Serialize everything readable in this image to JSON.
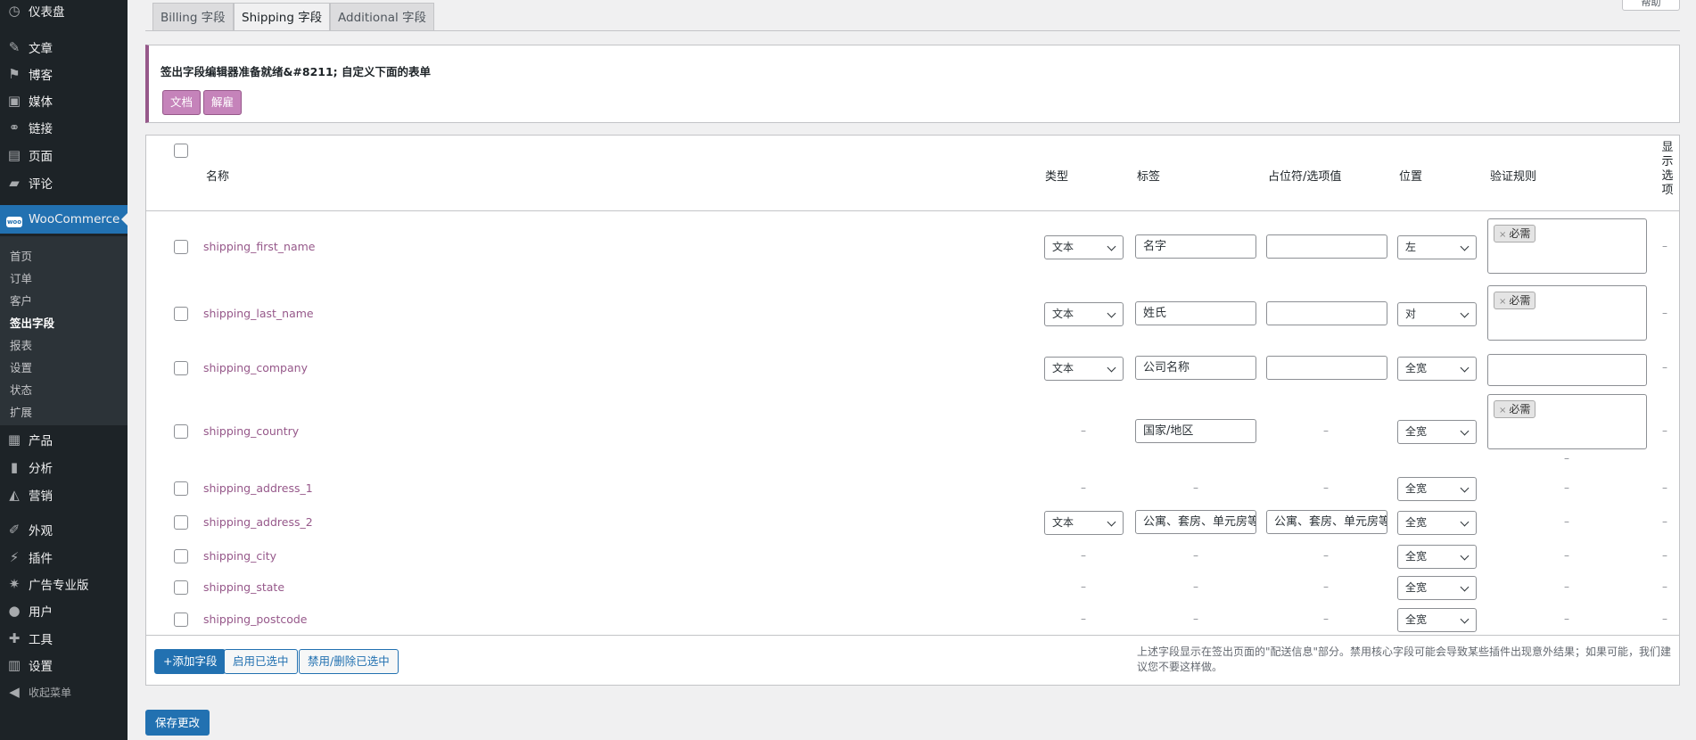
{
  "sidebar": {
    "menu": [
      {
        "label": "仪表盘",
        "icon": "dashboard-icon",
        "glyph": "◷"
      },
      {
        "label": "文章",
        "icon": "pin-icon",
        "glyph": "✎"
      },
      {
        "label": "博客",
        "icon": "flag-icon",
        "glyph": "⚑"
      },
      {
        "label": "媒体",
        "icon": "media-icon",
        "glyph": "▣"
      },
      {
        "label": "链接",
        "icon": "link-icon",
        "glyph": "⚭"
      },
      {
        "label": "页面",
        "icon": "page-icon",
        "glyph": "▤"
      },
      {
        "label": "评论",
        "icon": "comment-icon",
        "glyph": "▰"
      },
      {
        "label": "WooCommerce",
        "icon": "woo-icon",
        "glyph": "woo"
      },
      {
        "label": "产品",
        "icon": "archive-icon",
        "glyph": "▦"
      },
      {
        "label": "分析",
        "icon": "chart-icon",
        "glyph": "▮"
      },
      {
        "label": "营销",
        "icon": "megaphone-icon",
        "glyph": "◭"
      },
      {
        "label": "外观",
        "icon": "brush-icon",
        "glyph": "✐"
      },
      {
        "label": "插件",
        "icon": "plugin-icon",
        "glyph": "⚡"
      },
      {
        "label": "广告专业版",
        "icon": "star-icon",
        "glyph": "✷"
      },
      {
        "label": "用户",
        "icon": "user-icon",
        "glyph": "●"
      },
      {
        "label": "工具",
        "icon": "wrench-icon",
        "glyph": "✚"
      },
      {
        "label": "设置",
        "icon": "settings-icon",
        "glyph": "▥"
      },
      {
        "label": "收起菜单",
        "icon": "collapse-icon",
        "glyph": "◀"
      }
    ],
    "submenu": [
      "首页",
      "订单",
      "客户",
      "签出字段",
      "报表",
      "设置",
      "状态",
      "扩展"
    ]
  },
  "tabs": [
    "Billing 字段",
    "Shipping 字段",
    "Additional 字段"
  ],
  "help_label": "帮助",
  "notice": {
    "message": "签出字段编辑器准备就绪&#8211; 自定义下面的表单",
    "btn_docs": "文档",
    "btn_dismiss": "解雇"
  },
  "table": {
    "headers": {
      "name": "名称",
      "type": "类型",
      "label": "标签",
      "placeholder": "占位符/选项值",
      "position": "位置",
      "validation": "验证规则",
      "display": "显示选项"
    },
    "dash": "–",
    "chip_remove": "×",
    "rows": [
      {
        "name": "shipping_first_name",
        "type": "文本",
        "label": "名字",
        "placeholder": "",
        "position": "左",
        "validation": "必需"
      },
      {
        "name": "shipping_last_name",
        "type": "文本",
        "label": "姓氏",
        "placeholder": "",
        "position": "对",
        "validation": "必需"
      },
      {
        "name": "shipping_company",
        "type": "文本",
        "label": "公司名称",
        "placeholder": "",
        "position": "全宽",
        "validation": ""
      },
      {
        "name": "shipping_country",
        "type": null,
        "label": "国家/地区",
        "placeholder": null,
        "position": "全宽",
        "validation": "必需"
      },
      {
        "name": "shipping_address_1",
        "type": null,
        "label": null,
        "placeholder": null,
        "position": "全宽",
        "validation": null
      },
      {
        "name": "shipping_address_2",
        "type": "文本",
        "label": "公寓、套房、单元房等",
        "placeholder": "公寓、套房、单元房等",
        "position": "全宽",
        "validation": null
      },
      {
        "name": "shipping_city",
        "type": null,
        "label": null,
        "placeholder": null,
        "position": "全宽",
        "validation": null
      },
      {
        "name": "shipping_state",
        "type": null,
        "label": null,
        "placeholder": null,
        "position": "全宽",
        "validation": null
      },
      {
        "name": "shipping_postcode",
        "type": null,
        "label": null,
        "placeholder": null,
        "position": "全宽",
        "validation": null
      }
    ],
    "footer": {
      "add_field": "+添加字段",
      "enable_selected": "启用已选中",
      "disable_selected": "禁用/删除已选中",
      "note": "上述字段显示在签出页面的\"配送信息\"部分。禁用核心字段可能会导致某些插件出现意外结果；如果可能，我们建议您不要这样做。"
    }
  },
  "save_label": "保存更改",
  "colors": {
    "sidebar": "#1d2327",
    "accent": "#2271b1",
    "woo_purple": "#96588a"
  }
}
